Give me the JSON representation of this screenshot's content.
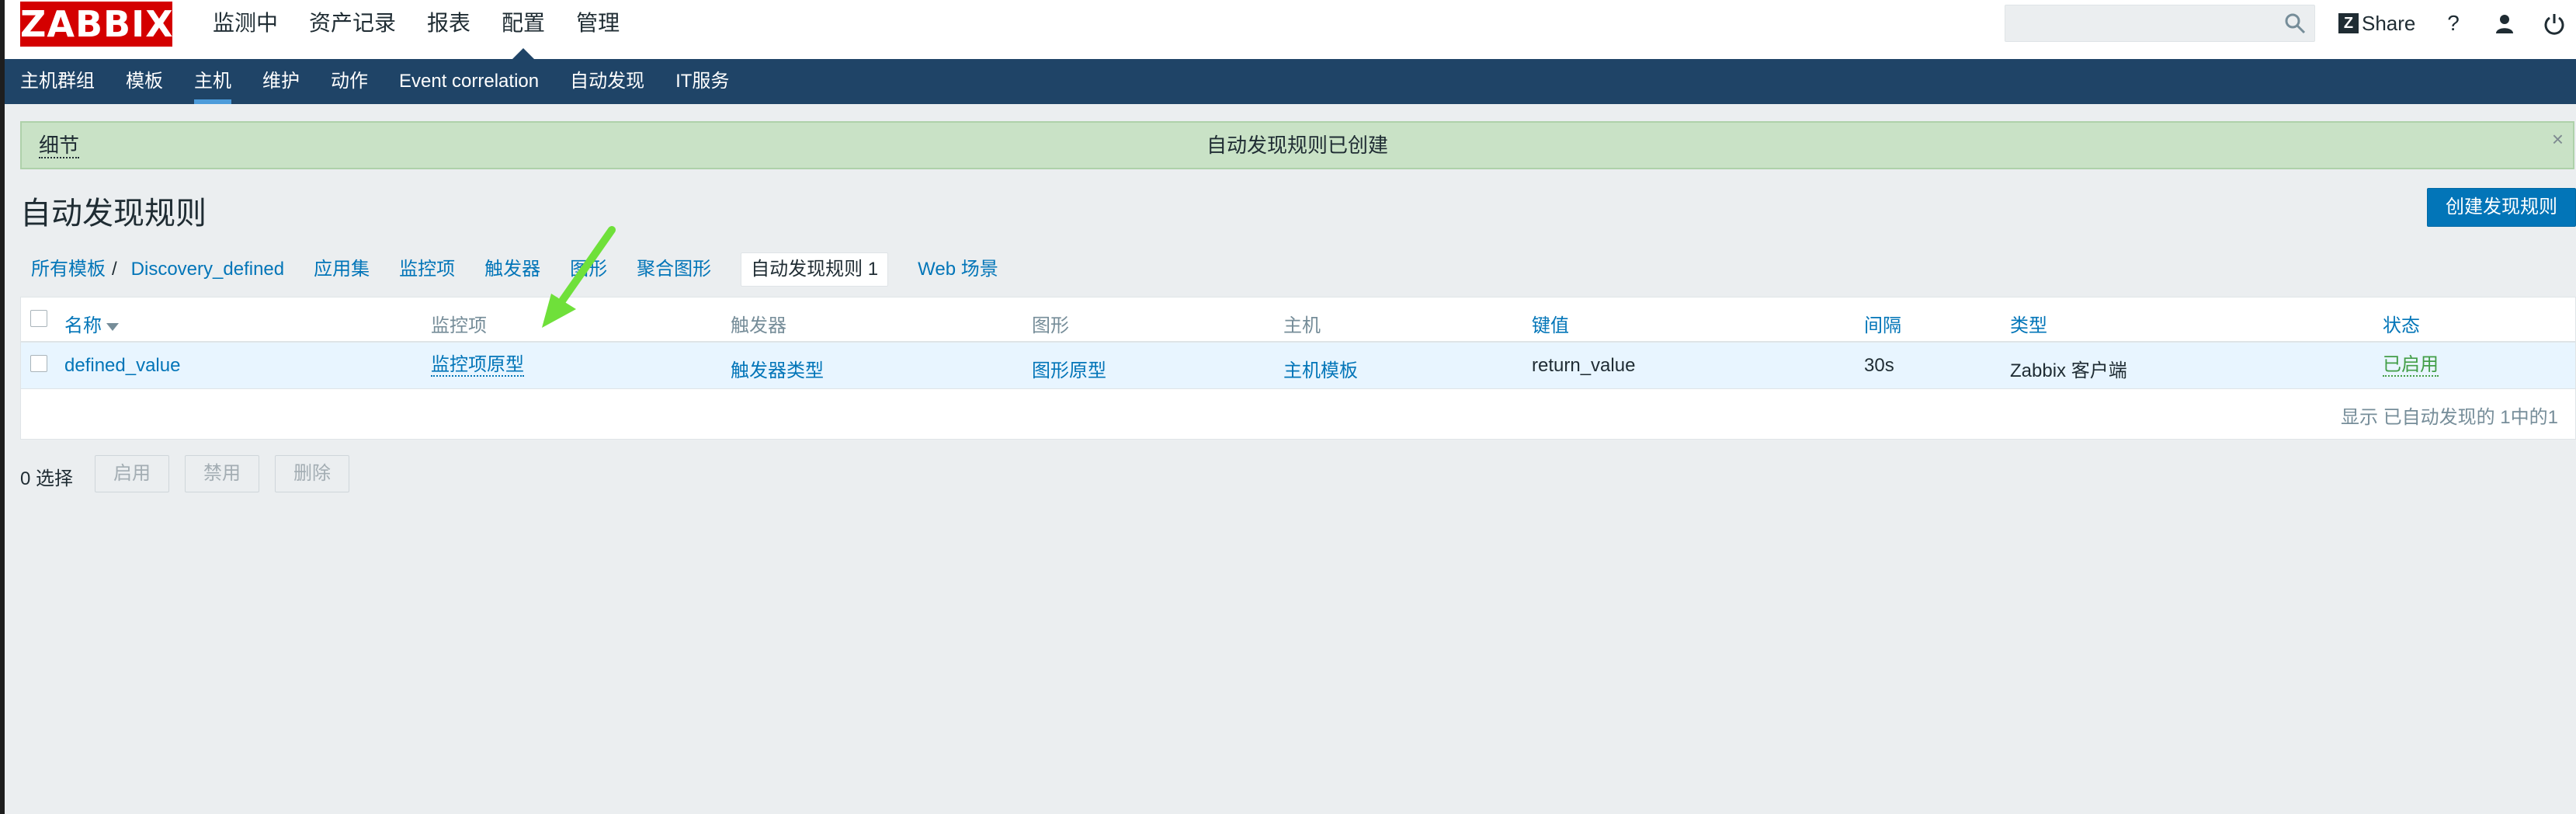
{
  "header": {
    "logo": "ZABBIX",
    "menu": [
      "监测中",
      "资产记录",
      "报表",
      "配置",
      "管理"
    ],
    "active_menu_index": 3,
    "share_label": "Share",
    "help_label": "?"
  },
  "subnav": {
    "items": [
      "主机群组",
      "模板",
      "主机",
      "维护",
      "动作",
      "Event correlation",
      "自动发现",
      "IT服务"
    ],
    "active_index": 2
  },
  "message": {
    "details_label": "细节",
    "text": "自动发现规则已创建",
    "close_label": "×"
  },
  "page": {
    "title": "自动发现规则",
    "create_button": "创建发现规则"
  },
  "breadcrumbs": {
    "all_templates": "所有模板",
    "separator": "/",
    "template": "Discovery_defined",
    "tabs": [
      "应用集",
      "监控项",
      "触发器",
      "图形",
      "聚合图形",
      "自动发现规则 1",
      "Web 场景"
    ]
  },
  "table": {
    "headers": {
      "name": "名称",
      "items": "监控项",
      "triggers": "触发器",
      "graphs": "图形",
      "hosts": "主机",
      "key": "键值",
      "interval": "间隔",
      "type": "类型",
      "status": "状态"
    },
    "rows": [
      {
        "name": "defined_value",
        "items": "监控项原型",
        "triggers": "触发器类型",
        "graphs": "图形原型",
        "hosts": "主机模板",
        "key": "return_value",
        "interval": "30s",
        "type": "Zabbix 客户端",
        "status": "已启用"
      }
    ],
    "footer": "显示 已自动发现的 1中的1"
  },
  "actions": {
    "selected": "0 选择",
    "enable": "启用",
    "disable": "禁用",
    "delete": "删除"
  },
  "colors": {
    "navbar": "#1f4467",
    "link": "#0275b8",
    "success_bg": "#c9e2c6",
    "logo_red": "#d40000",
    "status_green": "#429e47",
    "annotation_arrow": "#6fe03a"
  }
}
